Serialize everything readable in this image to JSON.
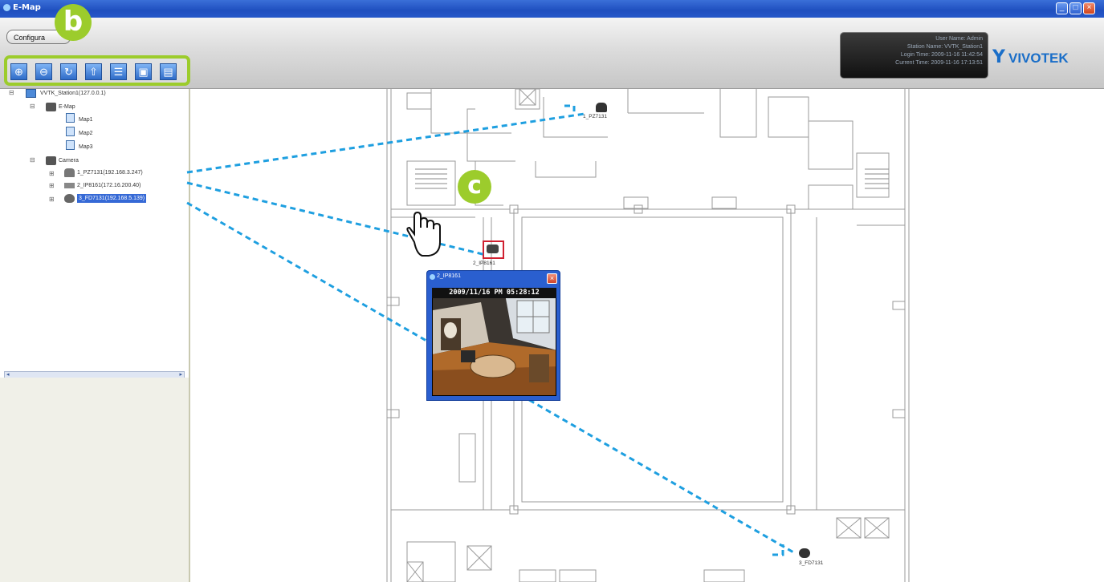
{
  "window": {
    "title": "E-Map"
  },
  "toolbar": {
    "config_label": "Configura",
    "tool_icons": [
      "zoom-in-icon",
      "zoom-out-icon",
      "refresh-icon",
      "export-icon",
      "layout-icon",
      "fullscreen-icon",
      "save-icon"
    ]
  },
  "badges": {
    "b": "b",
    "c": "c"
  },
  "station_info": {
    "user_name": "User Name: Admin",
    "station_name": "Station Name: VVTK_Station1",
    "login_time": "Login Time: 2009-11-16 11:42:54",
    "current_time": "Current Time: 2009-11-16 17:13:51"
  },
  "logo": {
    "text": "VIVOTEK"
  },
  "tree": {
    "station": "VVTK_Station1(127.0.0.1)",
    "emap": "E-Map",
    "maps": [
      "Map1",
      "Map2",
      "Map3"
    ],
    "camera_group": "Camera",
    "cameras": [
      "1_PZ7131(192.168.3.247)",
      "2_IP8161(172.16.200.40)",
      "3_FD7131(192.168.5.139)"
    ]
  },
  "map_cameras": [
    {
      "label": "1_PZ7131"
    },
    {
      "label": "2_IP8161"
    },
    {
      "label": "3_FD7131"
    }
  ],
  "popup": {
    "title": "2_IP8161",
    "timestamp": "2009/11/16 PM 05:28:12"
  },
  "colors": {
    "accent_green": "#9ccc2c",
    "link_blue": "#1e9fe0",
    "titlebar_blue": "#2557c9"
  }
}
